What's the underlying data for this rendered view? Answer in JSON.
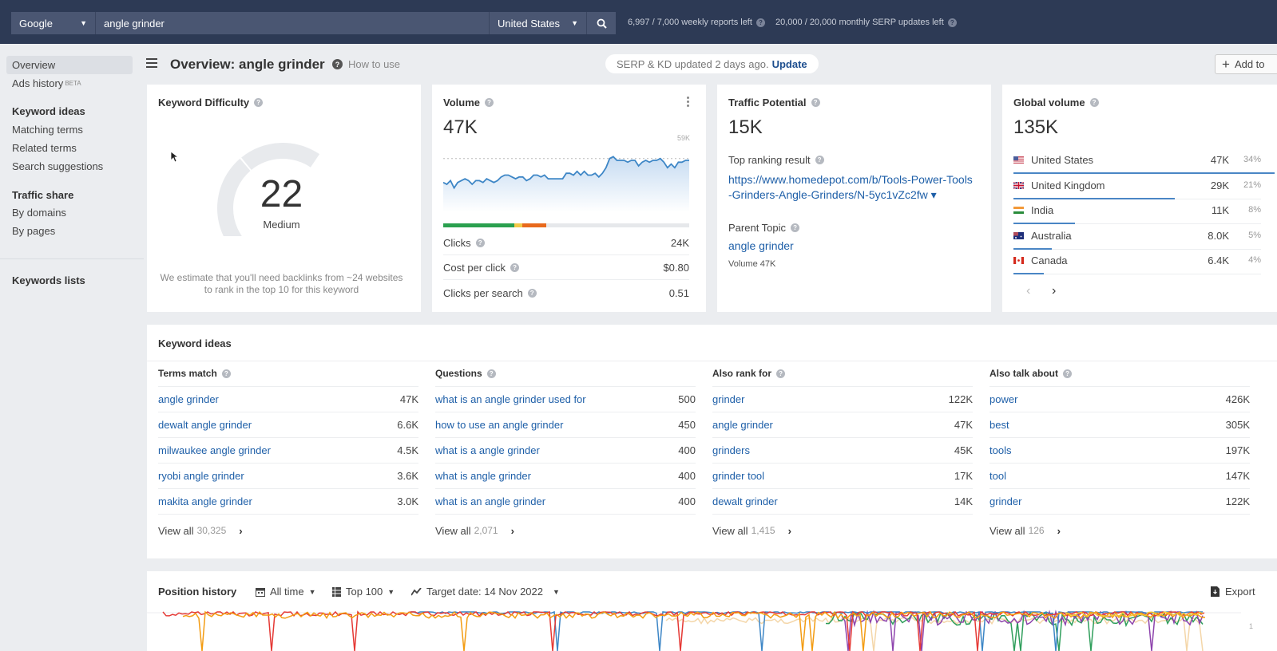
{
  "topbar": {
    "engine": "Google",
    "query": "angle grinder",
    "country": "United States",
    "weekly_reports": "6,997 / 7,000 weekly reports left",
    "monthly_serp": "20,000 / 20,000 monthly SERP updates left"
  },
  "sidebar": {
    "overview": "Overview",
    "ads_history": "Ads history",
    "beta": "BETA",
    "keyword_ideas_head": "Keyword ideas",
    "matching_terms": "Matching terms",
    "related_terms": "Related terms",
    "search_suggestions": "Search suggestions",
    "traffic_share_head": "Traffic share",
    "by_domains": "By domains",
    "by_pages": "By pages",
    "keywords_lists": "Keywords lists"
  },
  "header": {
    "title": "Overview: angle grinder",
    "how_to_use": "How to use",
    "update_text": "SERP & KD updated 2 days ago.",
    "update_link": "Update",
    "add_to": "Add to"
  },
  "kd": {
    "title": "Keyword Difficulty",
    "value": "22",
    "score": 22,
    "label": "Medium",
    "note_line1": "We estimate that you'll need backlinks from ~24 websites",
    "note_line2": "to rank in the top 10 for this keyword"
  },
  "volume": {
    "title": "Volume",
    "value": "47K",
    "chart_max_label": "59K",
    "trend": [
      34,
      33,
      35,
      31,
      34,
      35,
      36,
      35,
      33,
      35,
      35,
      34,
      36,
      35,
      34,
      35,
      37,
      38,
      38,
      37,
      36,
      37,
      37,
      35,
      36,
      38,
      38,
      37,
      38,
      36,
      36,
      36,
      36,
      36,
      39,
      39,
      38,
      40,
      38,
      40,
      38,
      38,
      39,
      37,
      39,
      42,
      47,
      48,
      46,
      46,
      46,
      45,
      46,
      46,
      43,
      45,
      46,
      45,
      46,
      46,
      47,
      45,
      42,
      44,
      42,
      45,
      45,
      46,
      46
    ],
    "click_split": {
      "organic_pct": 29,
      "mixed_pct": 3,
      "paid_pct": 10
    },
    "clicks_label": "Clicks",
    "clicks": "24K",
    "cpc_label": "Cost per click",
    "cpc": "$0.80",
    "cps_label": "Clicks per search",
    "cps": "0.51"
  },
  "traffic_potential": {
    "title": "Traffic Potential",
    "value": "15K",
    "top_result_label": "Top ranking result",
    "top_result_url": "https://www.homedepot.com/b/Tools-Power-Tools-Grinders-Angle-Grinders/N-5yc1vZc2fw ▾",
    "parent_topic_label": "Parent Topic",
    "parent_topic": "angle grinder",
    "parent_volume": "Volume 47K"
  },
  "global_volume": {
    "title": "Global volume",
    "value": "135K",
    "countries": [
      {
        "name": "United States",
        "volume": "47K",
        "pct": "34%",
        "share": 34,
        "flag": "us"
      },
      {
        "name": "United Kingdom",
        "volume": "29K",
        "pct": "21%",
        "share": 21,
        "flag": "uk"
      },
      {
        "name": "India",
        "volume": "11K",
        "pct": "8%",
        "share": 8,
        "flag": "in"
      },
      {
        "name": "Australia",
        "volume": "8.0K",
        "pct": "5%",
        "share": 5,
        "flag": "au"
      },
      {
        "name": "Canada",
        "volume": "6.4K",
        "pct": "4%",
        "share": 4,
        "flag": "ca"
      }
    ]
  },
  "keyword_ideas": {
    "title": "Keyword ideas",
    "view_all": "View all",
    "columns": [
      {
        "head": "Terms match",
        "count": "30,325",
        "rows": [
          {
            "kw": "angle grinder",
            "v": "47K"
          },
          {
            "kw": "dewalt angle grinder",
            "v": "6.6K"
          },
          {
            "kw": "milwaukee angle grinder",
            "v": "4.5K"
          },
          {
            "kw": "ryobi angle grinder",
            "v": "3.6K"
          },
          {
            "kw": "makita angle grinder",
            "v": "3.0K"
          }
        ]
      },
      {
        "head": "Questions",
        "count": "2,071",
        "rows": [
          {
            "kw": "what is an angle grinder used for",
            "v": "500"
          },
          {
            "kw": "how to use an angle grinder",
            "v": "450"
          },
          {
            "kw": "what is a angle grinder",
            "v": "400"
          },
          {
            "kw": "what is angle grinder",
            "v": "400"
          },
          {
            "kw": "what is an angle grinder",
            "v": "400"
          }
        ]
      },
      {
        "head": "Also rank for",
        "count": "1,415",
        "rows": [
          {
            "kw": "grinder",
            "v": "122K"
          },
          {
            "kw": "angle grinder",
            "v": "47K"
          },
          {
            "kw": "grinders",
            "v": "45K"
          },
          {
            "kw": "grinder tool",
            "v": "17K"
          },
          {
            "kw": "dewalt grinder",
            "v": "14K"
          }
        ]
      },
      {
        "head": "Also talk about",
        "count": "126",
        "rows": [
          {
            "kw": "power",
            "v": "426K"
          },
          {
            "kw": "best",
            "v": "305K"
          },
          {
            "kw": "tools",
            "v": "197K"
          },
          {
            "kw": "tool",
            "v": "147K"
          },
          {
            "kw": "grinder",
            "v": "122K"
          }
        ]
      }
    ]
  },
  "position_history": {
    "title": "Position history",
    "period": "All time",
    "top": "Top 100",
    "target_date": "Target date: 14 Nov 2022",
    "export": "Export",
    "axis_top": "1"
  },
  "colors": {
    "topbar": "#2d3a55",
    "link": "#1e5fa8",
    "accent_blue": "#4a86c5",
    "kd_green": "#2aa84a",
    "ctr_green": "#2aa04f",
    "ctr_yellow": "#f3c948",
    "ctr_orange": "#e8691c"
  }
}
